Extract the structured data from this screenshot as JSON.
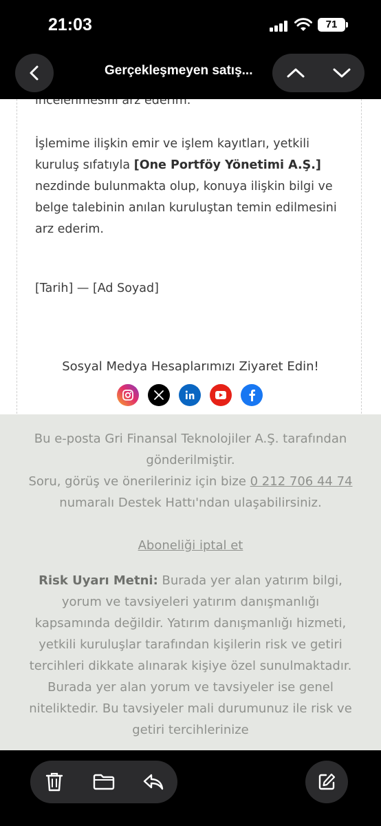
{
  "status_bar": {
    "time": "21:03",
    "battery": "71"
  },
  "nav": {
    "title": "Gerçekleşmeyen satış..."
  },
  "letter": {
    "cut_off_line": "incelenmesini arz ederim.",
    "p1_before": "İşlemime ilişkin emir ve işlem kayıtları, yetkili kuruluş sıfatıyla ",
    "p1_bold": "[One Portföy Yönetimi A.Ş.]",
    "p1_after": " nezdinde bulunmakta olup, konuya ilişkin bilgi ve belge talebinin anılan kuruluştan temin edilmesini arz ederim.",
    "signature": "[Tarih] — [Ad Soyad]"
  },
  "social": {
    "title": "Sosyal Medya Hesaplarımızı Ziyaret Edin!",
    "icons": [
      "instagram-icon",
      "x-icon",
      "linkedin-icon",
      "youtube-icon",
      "facebook-icon"
    ],
    "colors": {
      "instagram": "#e1306c",
      "x": "#000000",
      "linkedin": "#0a66c2",
      "youtube": "#e62117",
      "facebook": "#1877f2"
    }
  },
  "footer": {
    "sent_by": "Bu e-posta Gri Finansal Teknolojiler A.Ş. tarafından gönderilmiştir.",
    "support_before": "Soru, görüş ve önerileriniz için bize ",
    "support_phone": "0 212 706 44 74",
    "support_after": " numaralı Destek Hattı'ndan ulaşabilirsiniz.",
    "unsubscribe": "Aboneliği iptal et",
    "risk_label": "Risk Uyarı Metni:",
    "risk_text": " Burada yer alan yatırım bilgi, yorum ve tavsiyeleri yatırım danışmanlığı kapsamında değildir. Yatırım danışmanlığı hizmeti, yetkili kuruluşlar tarafından kişilerin risk ve getiri tercihleri dikkate alınarak kişiye özel sunulmaktadır. Burada yer alan yorum ve tavsiyeler ise genel niteliktedir. Bu tavsiyeler mali durumunuz ile risk ve getiri tercihlerinize"
  }
}
